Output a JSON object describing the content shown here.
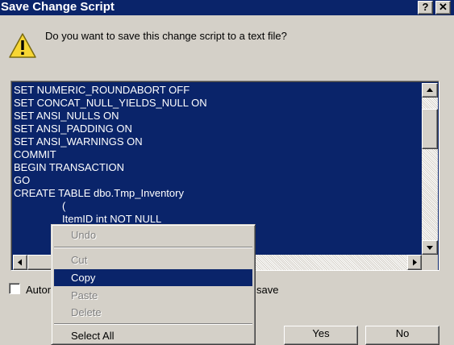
{
  "window": {
    "title": "Save Change Script",
    "help_glyph": "?",
    "close_glyph": "✕"
  },
  "dialog": {
    "icon": "warning-icon",
    "question": "Do you want to save this change script to a text file?"
  },
  "script": {
    "lines": [
      "SET NUMERIC_ROUNDABORT OFF",
      "SET CONCAT_NULL_YIELDS_NULL ON",
      "SET ANSI_NULLS ON",
      "SET ANSI_PADDING ON",
      "SET ANSI_WARNINGS ON",
      "COMMIT",
      "BEGIN TRANSACTION",
      "GO",
      "CREATE TABLE dbo.Tmp_Inventory",
      "\t(",
      "\tItemID int NOT NULL"
    ],
    "selection_color": "#0a246a"
  },
  "checkbox": {
    "checked": false,
    "label_visible_left": "Autor",
    "label_visible_right": "save"
  },
  "buttons": {
    "yes_label": "Yes",
    "no_label": "No"
  },
  "context_menu": {
    "items": [
      {
        "label": "Undo",
        "enabled": false,
        "highlighted": false
      },
      {
        "label": "Cut",
        "enabled": false,
        "highlighted": false
      },
      {
        "label": "Copy",
        "enabled": true,
        "highlighted": true
      },
      {
        "label": "Paste",
        "enabled": false,
        "highlighted": false
      },
      {
        "label": "Delete",
        "enabled": false,
        "highlighted": false
      },
      {
        "label": "Select All",
        "enabled": true,
        "highlighted": false
      }
    ]
  },
  "colors": {
    "title_bar": "#0a246a",
    "dialog_face": "#d4d0c8",
    "highlight": "#0a246a",
    "warning_yellow": "#f7d634"
  }
}
